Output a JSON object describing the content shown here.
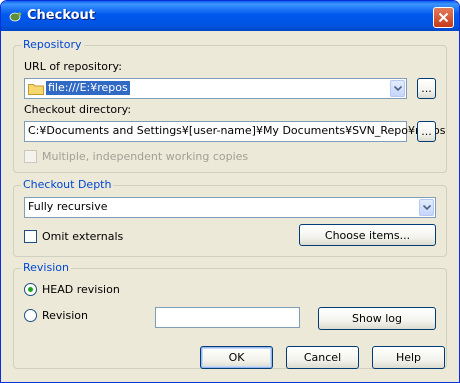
{
  "window": {
    "title": "Checkout"
  },
  "repository": {
    "legend": "Repository",
    "url_label": "URL of repository:",
    "url_value": "file:///E:¥repos",
    "url_browse": "...",
    "dir_label": "Checkout directory:",
    "dir_value": "C:¥Documents and Settings¥[user-name]¥My Documents¥SVN_Repo¥repos",
    "dir_browse": "...",
    "multiple_label": "Multiple, independent working copies"
  },
  "depth": {
    "legend": "Checkout Depth",
    "selected": "Fully recursive",
    "omit_label": "Omit externals",
    "choose_button": "Choose items..."
  },
  "revision": {
    "legend": "Revision",
    "head_label": "HEAD revision",
    "revision_label": "Revision",
    "revision_value": "",
    "showlog_button": "Show log"
  },
  "buttons": {
    "ok": "OK",
    "cancel": "Cancel",
    "help": "Help"
  },
  "colors": {
    "title_bar": "#0054e3",
    "group_legend": "#0046d5",
    "selection": "#316ac5",
    "dialog_bg": "#ece9d8"
  }
}
